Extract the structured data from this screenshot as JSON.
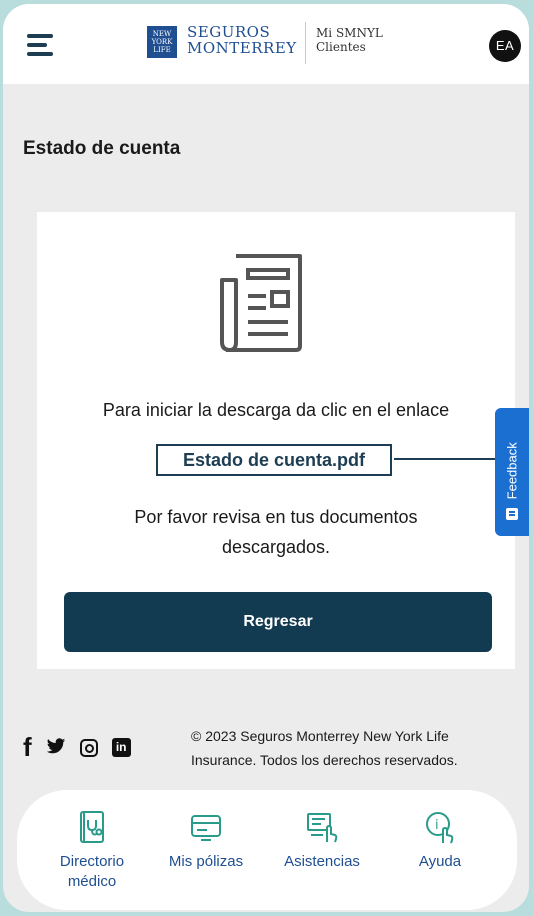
{
  "header": {
    "logo_badge": "NEW YORK LIFE",
    "logo_line1": "SEGUROS",
    "logo_line2": "MONTERREY",
    "app_line1": "Mi SMNYL",
    "app_line2": "Clientes",
    "avatar_initials": "EA",
    "menu_icon": "hamburger-menu-icon"
  },
  "page": {
    "title": "Estado de cuenta"
  },
  "card": {
    "icon": "newspaper-document-icon",
    "instruction": "Para iniciar la descarga da clic en el enlace",
    "link_label": "Estado de cuenta.pdf",
    "note_line1": "Por favor revisa en tus documentos",
    "note_line2": "descargados.",
    "back_button": "Regresar"
  },
  "feedback": {
    "label": "Feedback"
  },
  "footer": {
    "social_icons": [
      "facebook-icon",
      "twitter-icon",
      "instagram-icon",
      "linkedin-icon"
    ],
    "copyright_line1": "© 2023 Seguros Monterrey New York Life",
    "copyright_line2": "Insurance. Todos los derechos reservados."
  },
  "bottom_nav": {
    "items": [
      {
        "label_line1": "Directorio",
        "label_line2": "médico",
        "icon": "medical-directory-icon"
      },
      {
        "label_line1": "Mis pólizas",
        "label_line2": "",
        "icon": "policy-card-icon"
      },
      {
        "label_line1": "Asistencias",
        "label_line2": "",
        "icon": "assistance-computer-icon"
      },
      {
        "label_line1": "Ayuda",
        "label_line2": "",
        "icon": "help-info-icon"
      }
    ]
  },
  "colors": {
    "brand_navy": "#123b52",
    "brand_blue": "#1f4f91",
    "feedback_blue": "#1b6fd1",
    "page_bg": "#ececec"
  }
}
